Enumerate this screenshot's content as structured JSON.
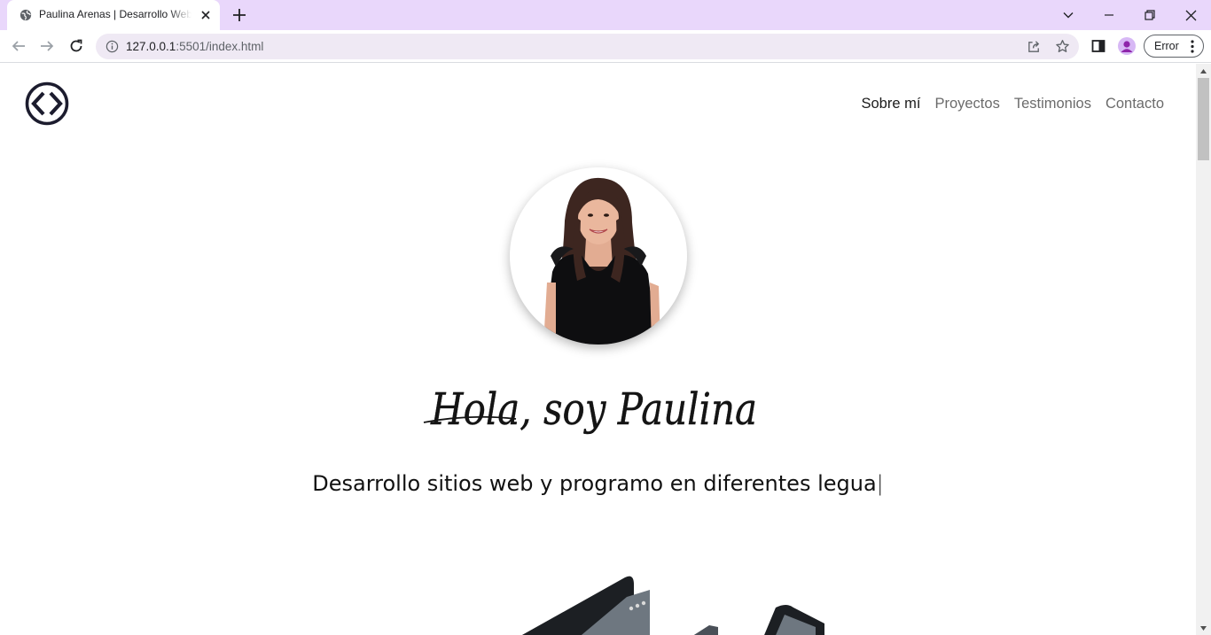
{
  "browser": {
    "tab_title": "Paulina Arenas | Desarrollo Web",
    "url_host": "127.0.0.1",
    "url_path": ":5501/index.html",
    "profile_button": "Error",
    "accent": "#e9d7fb"
  },
  "site": {
    "nav": [
      {
        "label": "Sobre mí",
        "active": true
      },
      {
        "label": "Proyectos",
        "active": false
      },
      {
        "label": "Testimonios",
        "active": false
      },
      {
        "label": "Contacto",
        "active": false
      }
    ],
    "greeting": "Hola, soy Paulina",
    "tagline": "Desarrollo sitios web y programo en diferentes legua",
    "caret": "|"
  },
  "icons": [
    "globe-icon",
    "close-icon",
    "plus-icon",
    "chevron-down-icon",
    "minimize-icon",
    "restore-icon",
    "back-icon",
    "forward-icon",
    "reload-icon",
    "info-icon",
    "share-icon",
    "star-icon",
    "side-panel-icon",
    "profile-icon",
    "more-icon",
    "code-logo-icon"
  ]
}
